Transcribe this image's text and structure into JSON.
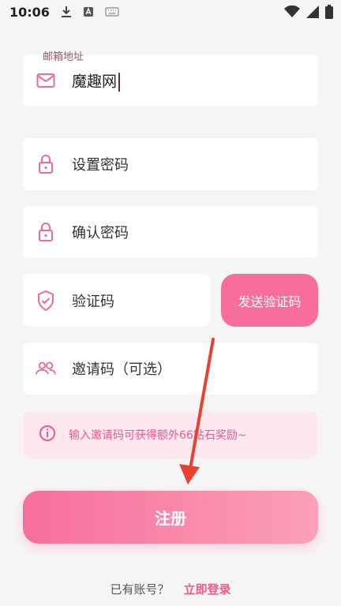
{
  "status_bar": {
    "time": "10:06"
  },
  "email": {
    "floating_label": "邮箱地址",
    "value": "魔趣网"
  },
  "password": {
    "placeholder": "设置密码"
  },
  "confirm_password": {
    "placeholder": "确认密码"
  },
  "verification": {
    "placeholder": "验证码",
    "send_button": "发送验证码"
  },
  "invite": {
    "placeholder": "邀请码（可选）"
  },
  "tip": {
    "text": "输入邀请码可获得额外66钻石奖励~"
  },
  "register_button": "注册",
  "footer": {
    "question": "已有账号？",
    "login_link": "立即登录"
  },
  "colors": {
    "accent": "#f76e9b",
    "tip_bg": "#fde8ef",
    "link": "#f05a8c"
  }
}
